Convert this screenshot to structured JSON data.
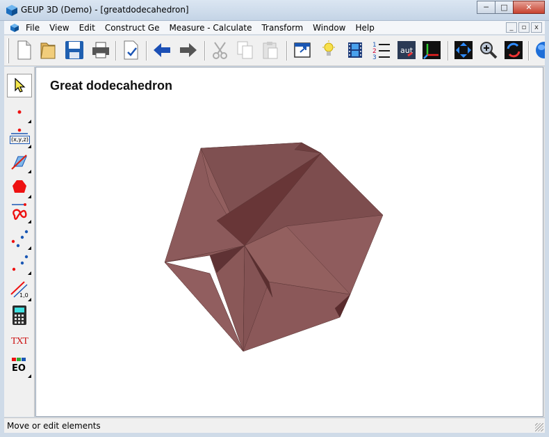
{
  "window": {
    "title": "GEUP 3D (Demo) - [greatdodecahedron]",
    "minimize_glyph": "─",
    "maximize_glyph": "□",
    "close_glyph": "✕"
  },
  "menu": {
    "items": [
      "File",
      "View",
      "Edit",
      "Construct Ge",
      "Measure - Calculate",
      "Transform",
      "Window",
      "Help"
    ],
    "mdi": [
      "_",
      "▫",
      "x"
    ]
  },
  "toolbar": {
    "icons": [
      "new-document-icon",
      "open-folder-icon",
      "save-disk-icon",
      "printer-icon",
      "print-preview-icon",
      "undo-arrow-icon",
      "redo-arrow-icon",
      "cut-scissors-icon",
      "copy-icon",
      "paste-icon",
      "window-icon",
      "lightbulb-icon",
      "film-icon",
      "numbered-list-icon",
      "auto-rotate-icon",
      "axes-icon",
      "fit-view-icon",
      "zoom-icon",
      "rotate-icon",
      "globe-icon"
    ]
  },
  "left_tools": {
    "icons": [
      "pointer-arrow-icon",
      "point-icon",
      "coordinate-point-icon",
      "plane-icon",
      "polygon-icon",
      "curve-icon",
      "points-icon",
      "points-line-icon",
      "measure-icon",
      "calculator-icon",
      "text-icon",
      "equation-icon"
    ],
    "coord_label": "(x,y,z)",
    "measure_label": "1,0",
    "text_label": "TXT",
    "equation_label": "EO"
  },
  "canvas": {
    "heading": "Great dodecahedron",
    "solid_color": "#8d5b5c"
  },
  "status": {
    "text": "Move or edit elements"
  },
  "colors": {
    "accent_blue": "#0a58c6",
    "title_bar": "#c8d7e8",
    "close_red": "#c7432f"
  }
}
